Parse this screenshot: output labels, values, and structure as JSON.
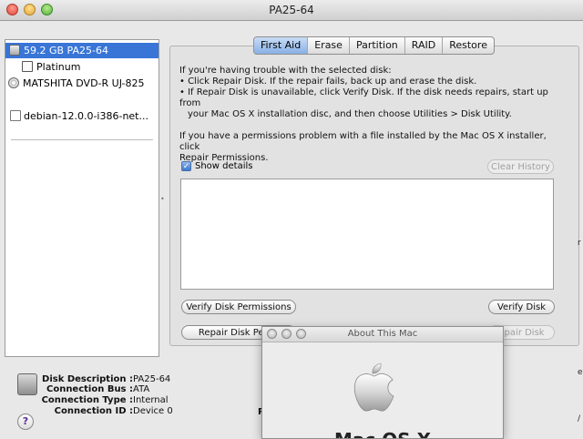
{
  "window": {
    "title": "PA25-64"
  },
  "sidebar": {
    "items": [
      {
        "label": "59.2 GB PA25-64",
        "icon": "hard-disk-icon",
        "selected": true
      },
      {
        "label": "Platinum",
        "icon": "volume-icon",
        "selected": false
      },
      {
        "label": "MATSHITA DVD-R UJ-825",
        "icon": "optical-drive-icon",
        "selected": false
      },
      {
        "label": "debian-12.0.0-i386-net...",
        "icon": "disk-image-icon",
        "selected": false
      }
    ]
  },
  "tabs": [
    {
      "label": "First Aid",
      "active": true
    },
    {
      "label": "Erase",
      "active": false
    },
    {
      "label": "Partition",
      "active": false
    },
    {
      "label": "RAID",
      "active": false
    },
    {
      "label": "Restore",
      "active": false
    }
  ],
  "first_aid": {
    "line1": "If you're having trouble with the selected disk:",
    "bullet1": "• Click Repair Disk. If the repair fails, back up and erase the disk.",
    "bullet2a": "• If Repair Disk is unavailable, click Verify Disk. If the disk needs repairs, start up from",
    "bullet2b": "your Mac OS X installation disc, and then choose Utilities > Disk Utility.",
    "perm1": "If you have a permissions problem with a file installed by the Mac OS X installer, click",
    "perm2": "Repair Permissions.",
    "show_details_label": "Show details",
    "show_details_checked": true,
    "clear_history_label": "Clear History",
    "verify_permissions_label": "Verify Disk Permissions",
    "verify_disk_label": "Verify Disk",
    "repair_permissions_label": "Repair Disk Permi",
    "repair_disk_label": "epair Disk"
  },
  "disk_info": {
    "rows": [
      {
        "key": "Disk Description :",
        "value": "PA25-64"
      },
      {
        "key": "Connection Bus :",
        "value": "ATA"
      },
      {
        "key": "Connection Type :",
        "value": "Internal"
      },
      {
        "key": "Connection ID :",
        "value": "Device 0"
      }
    ],
    "partial_label": "P"
  },
  "about_window": {
    "title": "About This Mac",
    "heading": "Mac OS X"
  },
  "help_label": "?",
  "colors": {
    "selection": "#3875d7",
    "tab_active": "#87b0e6"
  }
}
